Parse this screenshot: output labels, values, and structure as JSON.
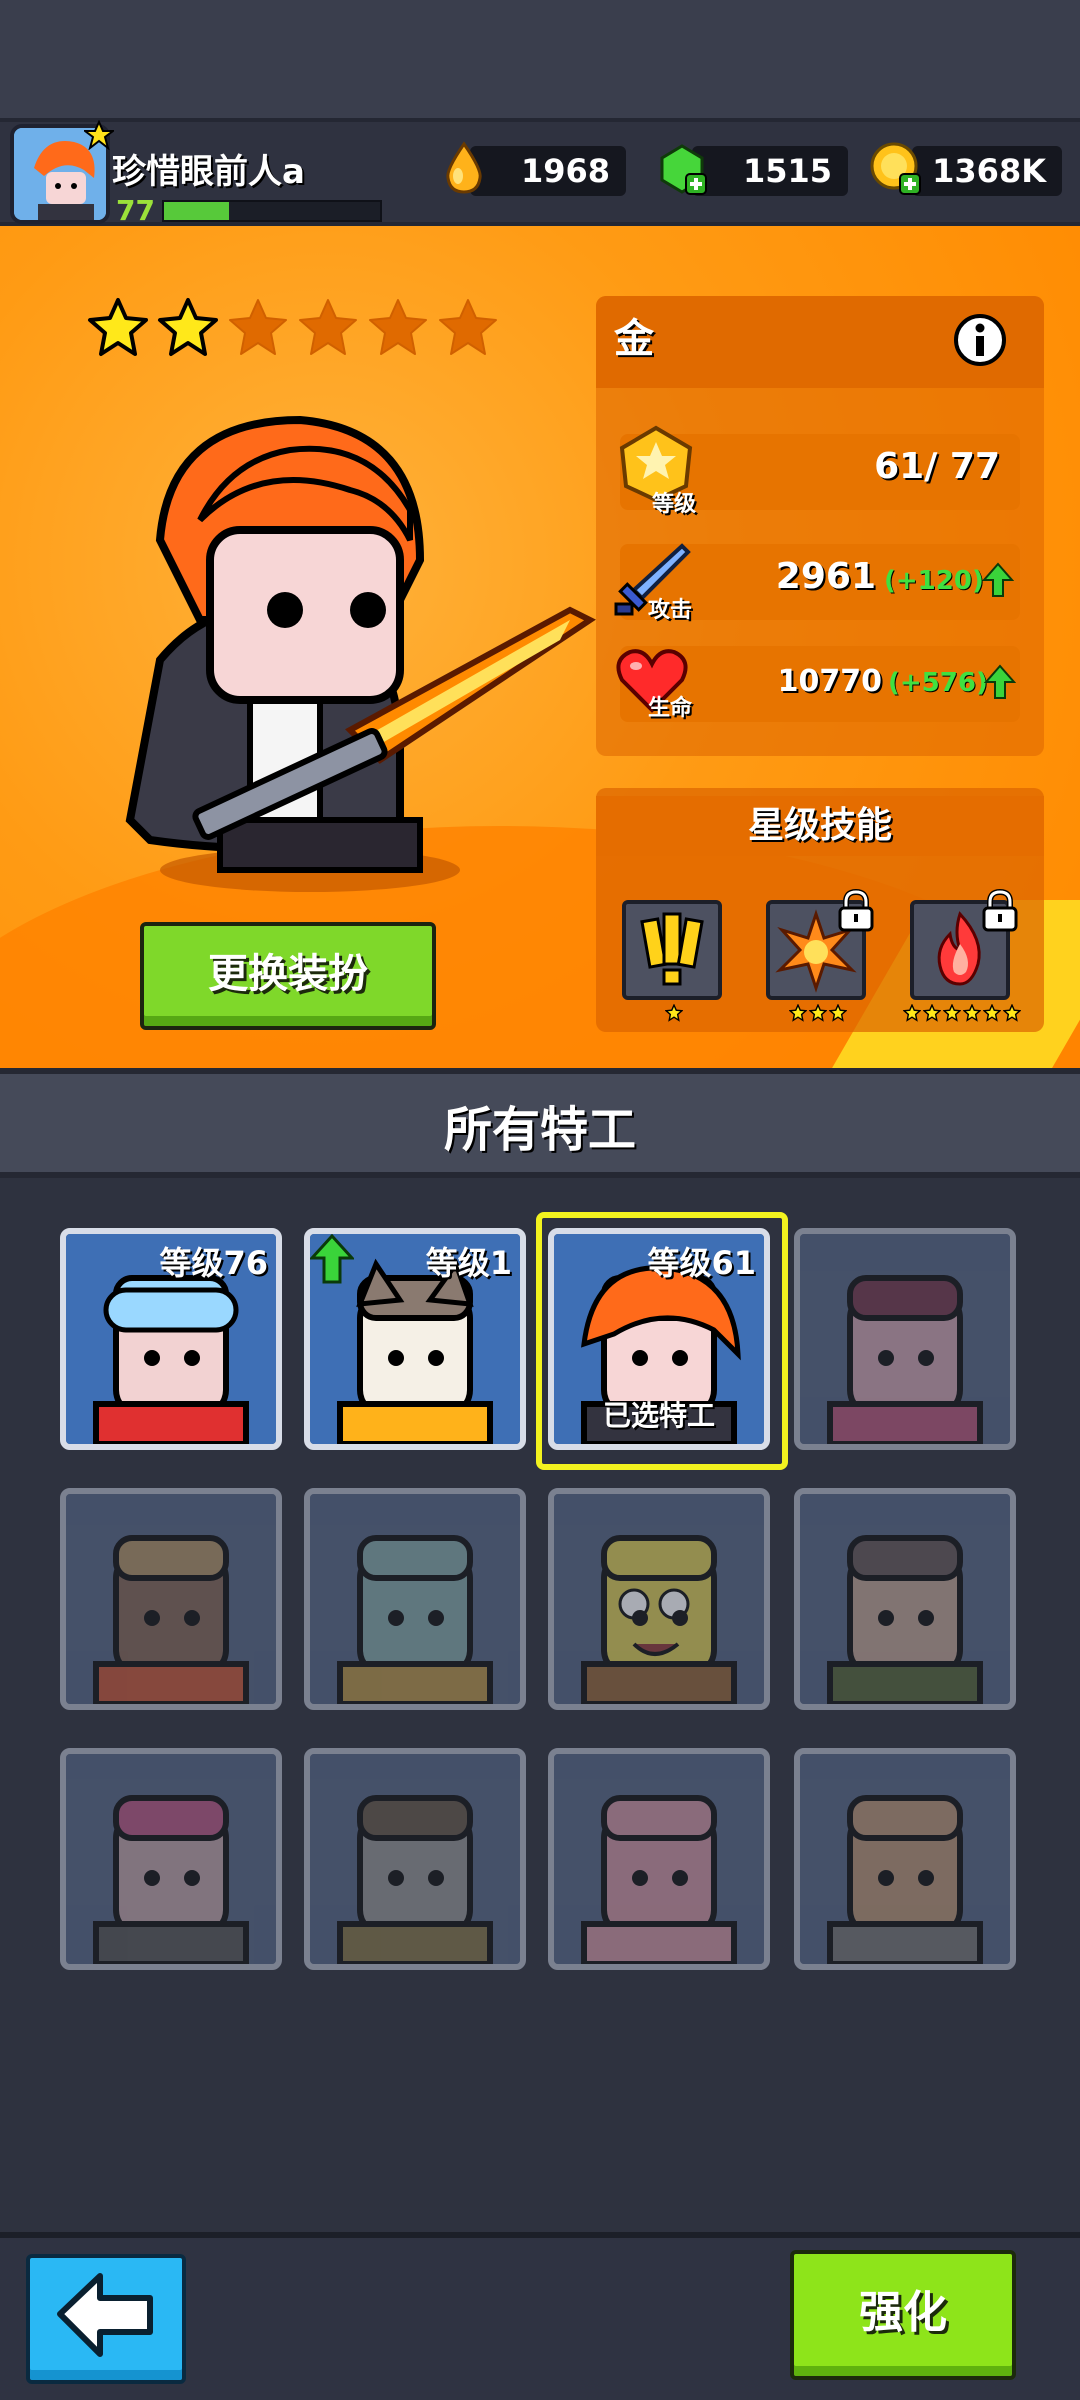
{
  "player": {
    "name": "珍惜眼前人a",
    "level": "77",
    "xp_fraction": 0.3
  },
  "currencies": {
    "oil": "1968",
    "gems": "1515",
    "gold": "1368K"
  },
  "hero": {
    "stars_filled": 2,
    "stars_total": 6,
    "grade": "金",
    "level_value": "61/ 77",
    "level_tag": "等级",
    "attack_value": "2961",
    "attack_bonus": "(+120)",
    "attack_tag": "攻击",
    "hp_value": "10770",
    "hp_bonus": "(+576)",
    "hp_tag": "生命",
    "skills_title": "星级技能",
    "skill_star_counts": [
      1,
      3,
      6
    ],
    "change_skin_label": "更换装扮"
  },
  "agents_section": {
    "title": "所有特工",
    "cards": [
      {
        "level": "等级76",
        "locked": false
      },
      {
        "level": "等级1",
        "locked": false,
        "upgradable": true
      },
      {
        "level": "等级61",
        "locked": false,
        "selected": true,
        "selected_label": "已选特工"
      },
      {
        "level": "",
        "locked": true
      },
      {
        "level": "",
        "locked": true
      },
      {
        "level": "",
        "locked": true
      },
      {
        "level": "",
        "locked": true
      },
      {
        "level": "",
        "locked": true
      },
      {
        "level": "",
        "locked": true
      },
      {
        "level": "",
        "locked": true
      },
      {
        "level": "",
        "locked": true
      },
      {
        "level": "",
        "locked": true
      }
    ]
  },
  "bottom": {
    "upgrade_label": "强化"
  },
  "colors": {
    "accent_orange": "#ff9b14",
    "accent_green": "#8ee41a",
    "selection_yellow": "#f3f31f"
  }
}
